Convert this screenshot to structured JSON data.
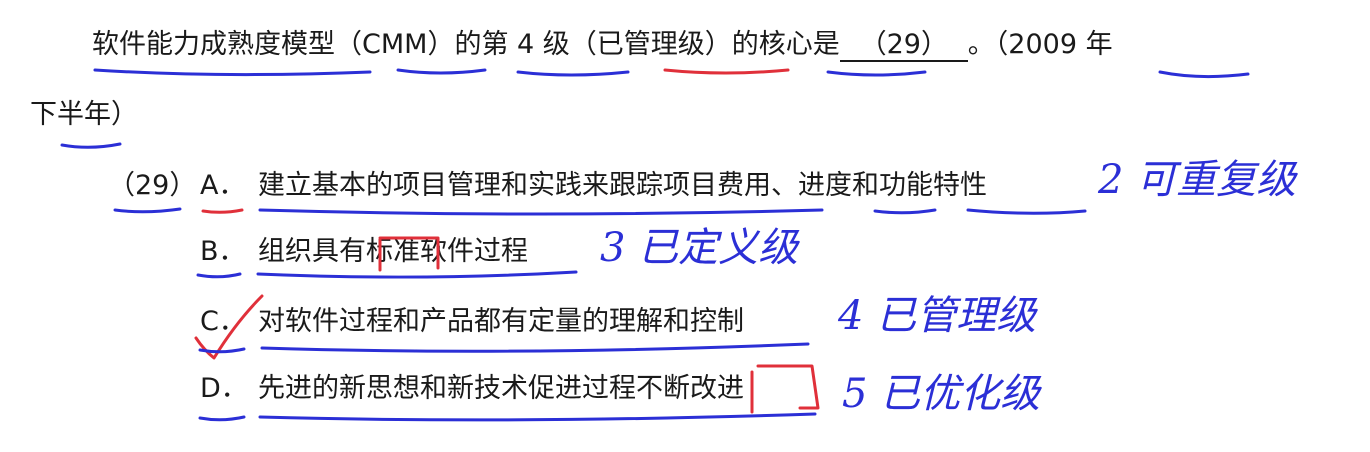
{
  "question": {
    "stem_before_blank": "软件能力成熟度模型（CMM）的第 4 级（已管理级）的核心是",
    "blank": "（29）",
    "stem_after_blank": "。（2009 年",
    "stem_line2": "下半年）",
    "number": "（29）"
  },
  "options": [
    {
      "letter": "A．",
      "text": "建立基本的项目管理和实践来跟踪项目费用、进度和功能特性"
    },
    {
      "letter": "B．",
      "text": "组织具有标准软件过程"
    },
    {
      "letter": "C．",
      "text": "对软件过程和产品都有定量的理解和控制"
    },
    {
      "letter": "D．",
      "text": "先进的新思想和新技术促进过程不断改进"
    }
  ],
  "annotations": {
    "A": "2 可重复级",
    "B": "3 已定义级",
    "C": "4 已管理级",
    "D": "5 已优化级"
  },
  "colors": {
    "text": "#1a1a1a",
    "ink_blue": "#2b2fd6",
    "ink_red": "#e0303a"
  }
}
